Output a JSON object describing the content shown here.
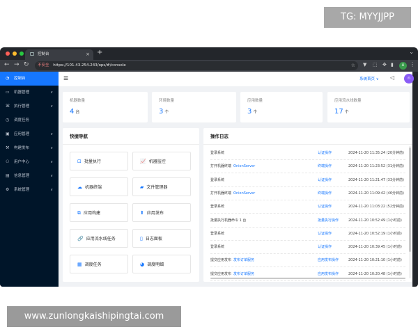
{
  "overlay": {
    "tg_label": "TG: MYYJJPP",
    "watermark": "www.zunlongkaishipingtai.com"
  },
  "browser": {
    "tab_title": "控制台",
    "tab_close": "×",
    "new_tab": "+",
    "insecure_label": "不安全",
    "url": "https://101.43.254.243/ops/#/console",
    "profile_initial": "A",
    "colors": {
      "close": "#ff5f57",
      "minimize": "#febc2e",
      "maximize": "#28c840"
    }
  },
  "sidebar": {
    "items": [
      {
        "label": "控制台",
        "icon": "dashboard-icon",
        "glyph": "◔",
        "expandable": false,
        "active": true
      },
      {
        "label": "机器管理",
        "icon": "monitor-icon",
        "glyph": "▭",
        "expandable": true,
        "active": false
      },
      {
        "label": "执行管理",
        "icon": "execute-icon",
        "glyph": "⌘",
        "expandable": true,
        "active": false
      },
      {
        "label": "调度任务",
        "icon": "schedule-icon",
        "glyph": "◷",
        "expandable": false,
        "active": false
      },
      {
        "label": "应用管理",
        "icon": "app-icon",
        "glyph": "▣",
        "expandable": true,
        "active": false
      },
      {
        "label": "构建发布",
        "icon": "build-icon",
        "glyph": "⚒",
        "expandable": true,
        "active": false
      },
      {
        "label": "用户中心",
        "icon": "user-icon",
        "glyph": "⚇",
        "expandable": true,
        "active": false
      },
      {
        "label": "信息管理",
        "icon": "info-icon",
        "glyph": "▤",
        "expandable": true,
        "active": false
      },
      {
        "label": "系统管理",
        "icon": "system-icon",
        "glyph": "⚙",
        "expandable": true,
        "active": false
      }
    ],
    "colors": {
      "background": "#001529",
      "active": "#1677ff"
    }
  },
  "header": {
    "home_label": "系统首页 ∨",
    "user_initial": "n",
    "colors": {
      "avatar": "#8a5cf6"
    }
  },
  "stats": [
    {
      "label": "机器数量",
      "value": "4",
      "unit": "台"
    },
    {
      "label": "环境数量",
      "value": "3",
      "unit": "个"
    },
    {
      "label": "应用数量",
      "value": "3",
      "unit": "个"
    },
    {
      "label": "应用流水线数量",
      "value": "17",
      "unit": "个"
    }
  ],
  "quick_nav": {
    "title": "快捷导航",
    "buttons": [
      {
        "label": "批量执行",
        "icon": "batch-execute-icon",
        "glyph": "⊡"
      },
      {
        "label": "机器监控",
        "icon": "monitor-chart-icon",
        "glyph": "📈"
      },
      {
        "label": "机器终端",
        "icon": "cloud-terminal-icon",
        "glyph": "☁"
      },
      {
        "label": "文件管理器",
        "icon": "folder-icon",
        "glyph": "▰"
      },
      {
        "label": "应用构建",
        "icon": "build-blocks-icon",
        "glyph": "⧉"
      },
      {
        "label": "应用发布",
        "icon": "deploy-icon",
        "glyph": "⬆"
      },
      {
        "label": "应用流水线任务",
        "icon": "pipeline-icon",
        "glyph": "🔗"
      },
      {
        "label": "日志面板",
        "icon": "log-icon",
        "glyph": "▯"
      },
      {
        "label": "调度任务",
        "icon": "calendar-icon",
        "glyph": "▦"
      },
      {
        "label": "调度明细",
        "icon": "gauge-icon",
        "glyph": "◕"
      }
    ]
  },
  "op_log": {
    "title": "操作日志",
    "rows": [
      {
        "action": "登录系统",
        "target": "",
        "type": "认证操作",
        "time": "2024-11-20 11:35:24 (20分钟前)"
      },
      {
        "action": "打开机器终端",
        "target": "OnionServer",
        "type": "终端操作",
        "time": "2024-11-20 11:23:52 (31分钟前)"
      },
      {
        "action": "登录系统",
        "target": "",
        "type": "认证操作",
        "time": "2024-11-20 11:21:47 (33分钟前)"
      },
      {
        "action": "打开机器终端",
        "target": "OnionServer",
        "type": "终端操作",
        "time": "2024-11-20 11:09:42 (46分钟前)"
      },
      {
        "action": "登录系统",
        "target": "",
        "type": "认证操作",
        "time": "2024-11-20 11:03:22 (52分钟前)"
      },
      {
        "action": "批量执行机器命令 1 台",
        "target": "",
        "type": "批量执行操作",
        "time": "2024-11-20 10:52:49 (1小时前)"
      },
      {
        "action": "登录系统",
        "target": "",
        "type": "认证操作",
        "time": "2024-11-20 10:52:19 (1小时前)"
      },
      {
        "action": "登录系统",
        "target": "",
        "type": "认证操作",
        "time": "2024-11-20 10:39:45 (1小时前)"
      },
      {
        "action": "提交应用发布",
        "target": "发布订单服务",
        "type": "应用发布操作",
        "time": "2024-11-20 10:21:10 (1小时前)"
      },
      {
        "action": "提交应用发布",
        "target": "发布订单服务",
        "type": "应用发布操作",
        "time": "2024-11-20 10:20:48 (1小时前)"
      }
    ]
  }
}
